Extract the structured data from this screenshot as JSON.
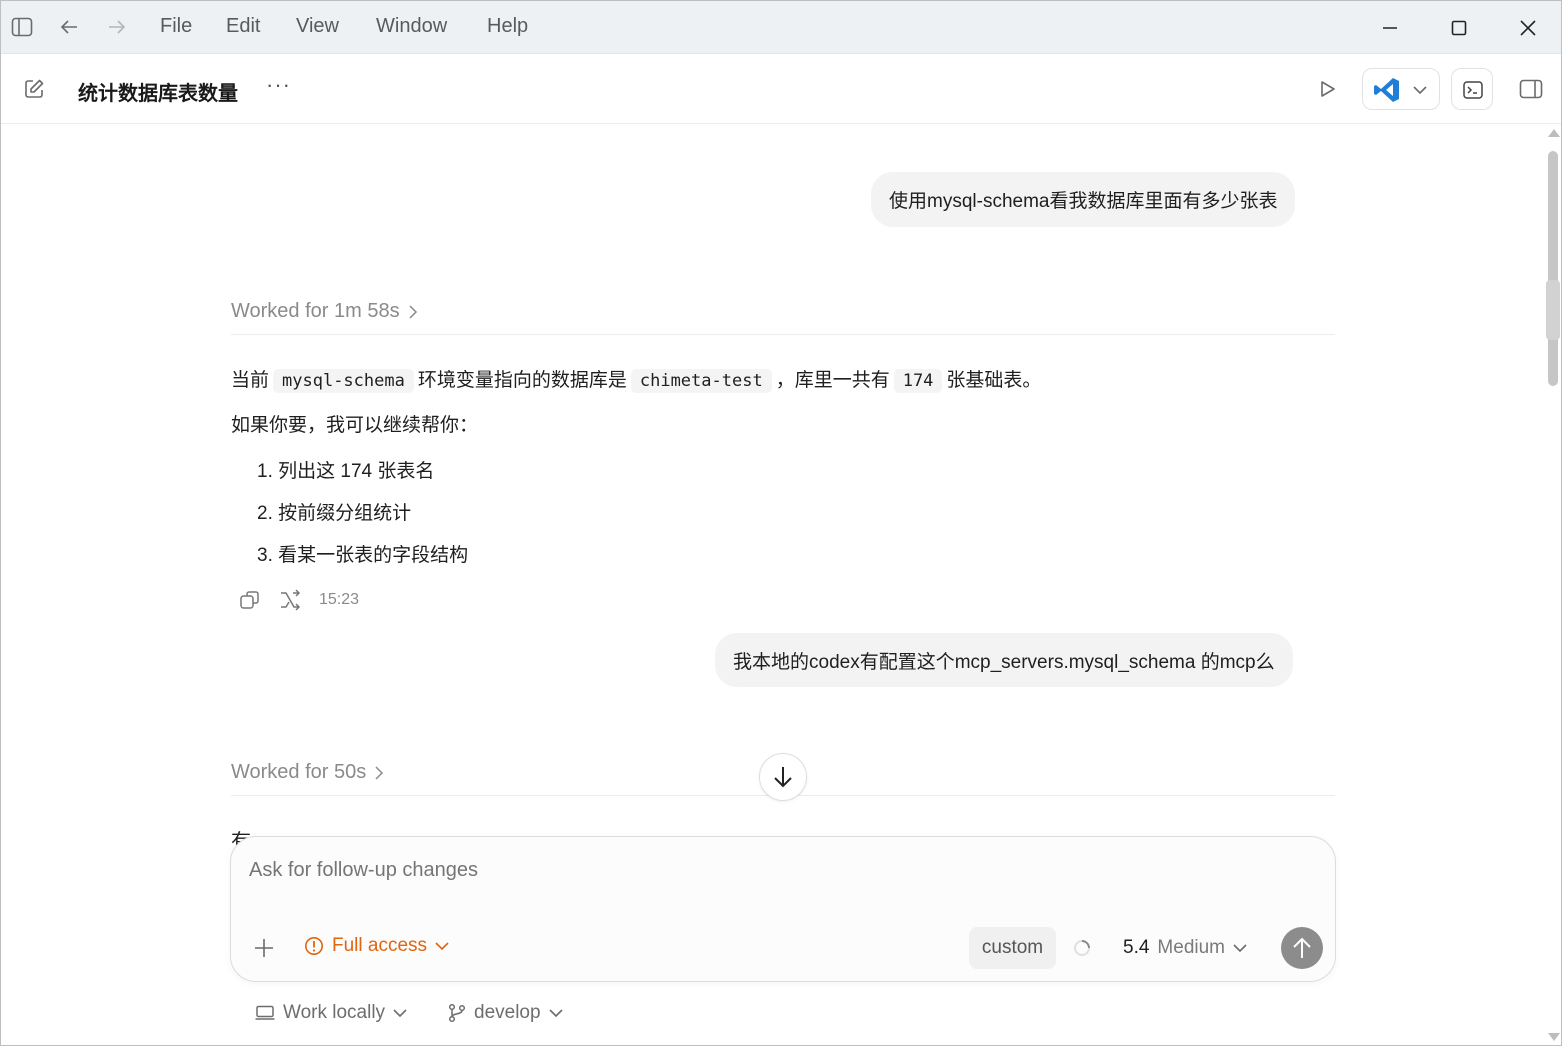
{
  "menu": {
    "file": "File",
    "edit": "Edit",
    "view": "View",
    "window": "Window",
    "help": "Help"
  },
  "toolbar": {
    "title": "统计数据库表数量",
    "more": "···"
  },
  "conversation": {
    "user_message_1": "使用mysql-schema看我数据库里面有多少张表",
    "worked_1": "Worked for 1m 58s",
    "answer": {
      "prefix": "当前",
      "code_1": "mysql-schema",
      "mid_1": "环境变量指向的数据库是",
      "code_2": "chimeta-test",
      "mid_2": "，库里一共有",
      "code_3": "174",
      "suffix": "张基础表。"
    },
    "offer": "如果你要，我可以继续帮你：",
    "options": [
      "1. 列出这 174 张表名",
      "2. 按前缀分组统计",
      "3. 看某一张表的字段结构"
    ],
    "timestamp": "15:23",
    "user_message_2": "我本地的codex有配置这个mcp_servers.mysql_schema 的mcp么",
    "worked_2": "Worked for 50s",
    "partial_text": "有"
  },
  "composer": {
    "placeholder": "Ask for follow-up changes",
    "access_label": "Full access",
    "custom_label": "custom",
    "model_version": "5.4",
    "model_effort": "Medium"
  },
  "footer": {
    "work_mode": "Work locally",
    "branch": "develop"
  },
  "colors": {
    "accent_orange": "#e0650f",
    "vscode_blue": "#1f7fd6",
    "send_button": "#8c8c8c"
  }
}
